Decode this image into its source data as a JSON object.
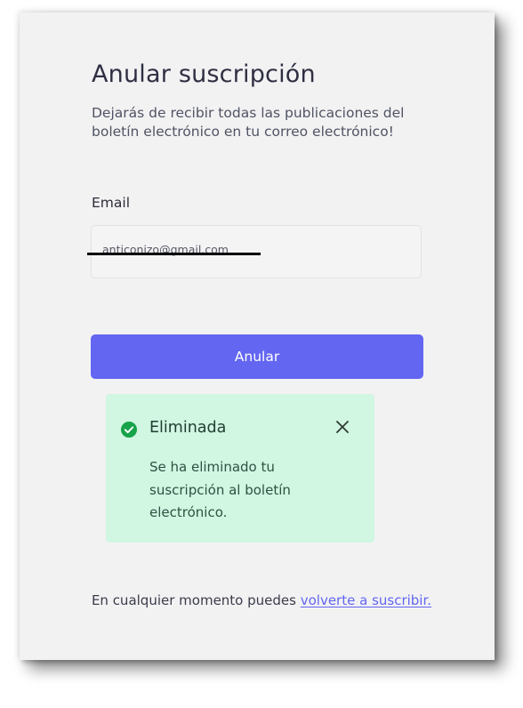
{
  "form": {
    "title": "Anular suscripción",
    "description": "Dejarás de recibir todas las publicaciones del boletín electrónico en tu correo electrónico!",
    "email_label": "Email",
    "email_value": "anticonizo@gmail.com",
    "submit_label": "Anular"
  },
  "toast": {
    "title": "Eliminada",
    "message": "Se ha eliminado tu suscripción al boletín electrónico.",
    "icon": "check-circle-icon",
    "close_icon": "close-icon"
  },
  "footer": {
    "text": "En cualquier momento puedes",
    "link_label": "volverte a suscribir."
  },
  "colors": {
    "accent": "#6366f1",
    "success_bg": "#d1f6e2",
    "success_icon": "#16a34a",
    "card_bg": "#f2f2f3"
  }
}
